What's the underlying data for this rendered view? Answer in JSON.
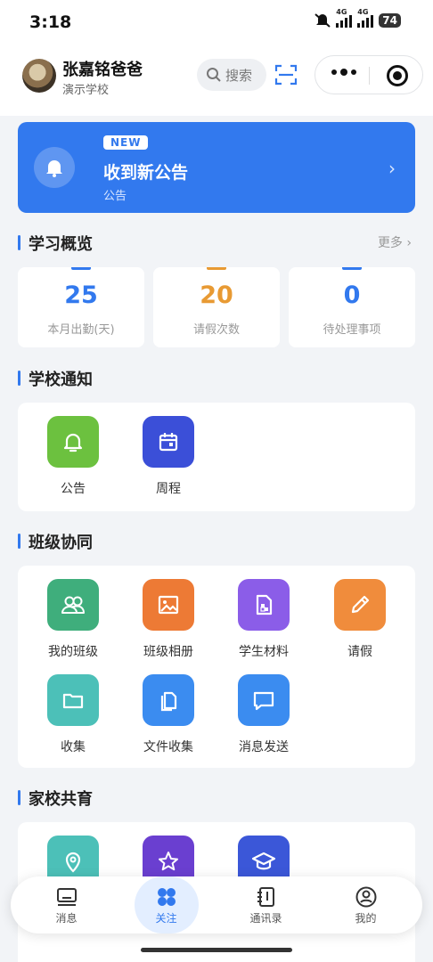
{
  "status": {
    "time": "3:18",
    "signal1": "4G",
    "signal2": "4G",
    "battery": "74"
  },
  "header": {
    "user_name": "张嘉铭爸爸",
    "school": "演示学校",
    "search_label": "搜索"
  },
  "notice": {
    "tag": "NEW",
    "title": "收到新公告",
    "subtitle": "公告"
  },
  "overview": {
    "title": "学习概览",
    "more": "更多",
    "stats": [
      {
        "value": "25",
        "label": "本月出勤(天)",
        "color": "#3279ee"
      },
      {
        "value": "20",
        "label": "请假次数",
        "color": "#e89a33"
      },
      {
        "value": "0",
        "label": "待处理事项",
        "color": "#3279ee"
      }
    ]
  },
  "school_notice": {
    "title": "学校通知",
    "items": [
      {
        "label": "公告",
        "icon": "bell-icon",
        "color": "#6cc13f"
      },
      {
        "label": "周程",
        "icon": "calendar-icon",
        "color": "#3b4fd8"
      }
    ]
  },
  "class_collab": {
    "title": "班级协同",
    "items": [
      {
        "label": "我的班级",
        "icon": "group-icon",
        "color": "#3fae7c"
      },
      {
        "label": "班级相册",
        "icon": "image-icon",
        "color": "#ed7a35"
      },
      {
        "label": "学生材料",
        "icon": "document-icon",
        "color": "#8b5de8"
      },
      {
        "label": "请假",
        "icon": "pencil-icon",
        "color": "#f08c3c"
      },
      {
        "label": "收集",
        "icon": "folder-icon",
        "color": "#4cc0b8"
      },
      {
        "label": "文件收集",
        "icon": "files-icon",
        "color": "#3b8cf0"
      },
      {
        "label": "消息发送",
        "icon": "message-icon",
        "color": "#3b8cf0"
      }
    ]
  },
  "home_school": {
    "title": "家校共育",
    "items": [
      {
        "icon": "location-icon",
        "color": "#4cc0b8"
      },
      {
        "icon": "star-icon",
        "color": "#6a3fd0"
      },
      {
        "icon": "graduation-cap-icon",
        "color": "#3b57d8"
      }
    ]
  },
  "tabbar": {
    "items": [
      {
        "label": "消息",
        "icon": "monitor-icon"
      },
      {
        "label": "关注",
        "icon": "grid-icon",
        "active": true
      },
      {
        "label": "通讯录",
        "icon": "contacts-icon"
      },
      {
        "label": "我的",
        "icon": "profile-icon"
      }
    ]
  }
}
